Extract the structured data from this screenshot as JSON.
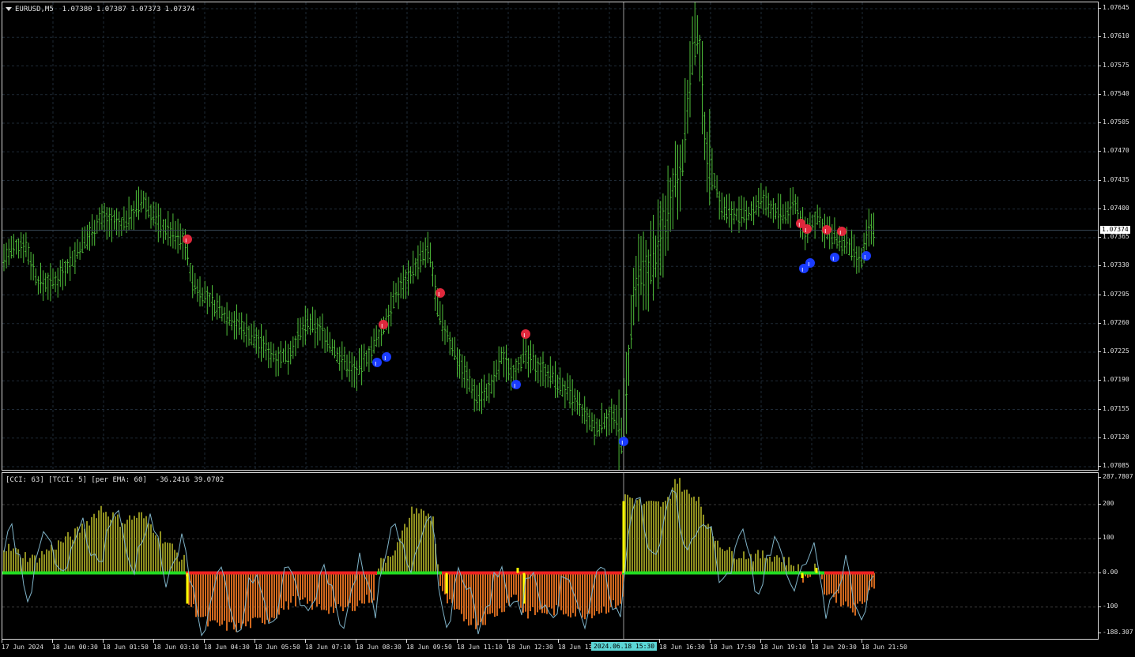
{
  "chart": {
    "symbol_label": "EURUSD,M5",
    "ohlc": "1.07380 1.07387 1.07373 1.07374",
    "current_price": "1.07374",
    "price_ticks": [
      "1.07645",
      "1.07610",
      "1.07575",
      "1.07540",
      "1.07505",
      "1.07470",
      "1.07435",
      "1.07400",
      "1.07365",
      "1.07330",
      "1.07295",
      "1.07260",
      "1.07225",
      "1.07190",
      "1.07155",
      "1.07120",
      "1.07085"
    ]
  },
  "indicator": {
    "label": "[CCI: 63] [TCCI: 5] [per EMA: 60]  -36.2416 39.0702",
    "ticks": [
      "287.7807",
      "200",
      "100",
      "0.00",
      "-100",
      "-188.307"
    ]
  },
  "time_axis": {
    "labels": [
      "17 Jun 2024",
      "18 Jun 00:30",
      "18 Jun 01:50",
      "18 Jun 03:10",
      "18 Jun 04:30",
      "18 Jun 05:50",
      "18 Jun 07:10",
      "18 Jun 08:30",
      "18 Jun 09:50",
      "18 Jun 11:10",
      "18 Jun 12:30",
      "18 Jun 13",
      "18 Jun 16:30",
      "18 Jun 17:50",
      "18 Jun 19:10",
      "18 Jun 20:30",
      "18 Jun 21:50"
    ],
    "crosshair_label": "2024.06.18 15:30"
  },
  "colors": {
    "background": "#000000",
    "bars": "#4fbf3a",
    "grid": "#1e2a36",
    "sell_signal": "#e0283c",
    "buy_signal": "#1a3cff",
    "cci_positive": "#8f8f1f",
    "cci_negative": "#d2691e",
    "line_up": "#22dd22",
    "line_down": "#ee2222",
    "tcci_line": "#7fb3c8"
  },
  "chart_data": {
    "type": "line",
    "title": "EURUSD,M5",
    "series": [
      {
        "name": "EURUSD,M5",
        "x": [
          "17 Jun 2024",
          "18 Jun 00:30",
          "18 Jun 01:50",
          "18 Jun 03:10",
          "18 Jun 04:30",
          "18 Jun 05:50",
          "18 Jun 07:10",
          "18 Jun 08:30",
          "18 Jun 09:50",
          "18 Jun 11:10",
          "18 Jun 12:30",
          "18 Jun 13:50",
          "18 Jun 15:30",
          "18 Jun 16:30",
          "18 Jun 17:50",
          "18 Jun 19:10",
          "18 Jun 20:30",
          "18 Jun 21:50"
        ],
        "values": [
          1.0734,
          1.0731,
          1.0739,
          1.0741,
          1.0728,
          1.0722,
          1.0724,
          1.0721,
          1.0735,
          1.072,
          1.0722,
          1.0716,
          1.0712,
          1.0762,
          1.0742,
          1.074,
          1.0736,
          1.07374
        ]
      }
    ],
    "ylim": [
      1.07085,
      1.07645
    ]
  }
}
